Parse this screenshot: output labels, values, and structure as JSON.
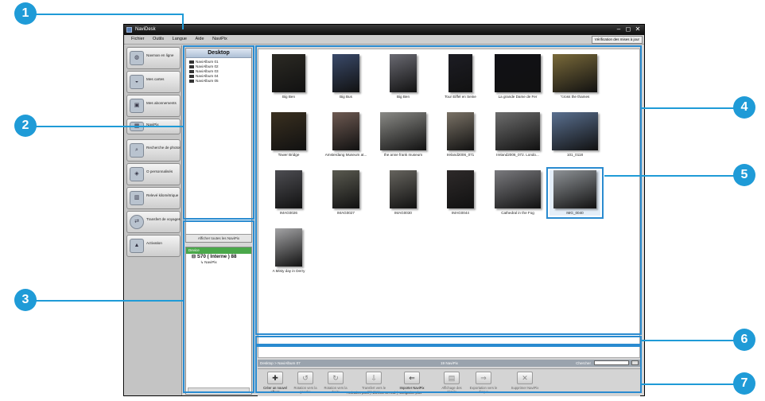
{
  "window": {
    "title": "NaviDesk",
    "minimize": "–",
    "maximize": "◻",
    "close": "✕"
  },
  "menu": {
    "items": [
      "Fichier",
      "Outils",
      "Langue",
      "Aide",
      "NaviPix"
    ],
    "update_button": "Vérification des mises à jour"
  },
  "sidebar": {
    "items": [
      {
        "label": "Navman en ligne",
        "icon": "globe-icon"
      },
      {
        "label": "Mes cartes",
        "icon": "map-icon"
      },
      {
        "label": "Mes abonnements",
        "icon": "subscription-icon"
      },
      {
        "label": "NaviPix",
        "icon": "photo-icon"
      },
      {
        "label": "Recherche de photos",
        "icon": "photo-search-icon"
      },
      {
        "label": "O personnalisés",
        "icon": "custom-poi-icon"
      },
      {
        "label": "Relevé kilométrique",
        "icon": "odometer-icon"
      },
      {
        "label": "Transfert de voyages",
        "icon": "transfer-icon"
      },
      {
        "label": "Activation",
        "icon": "lock-icon"
      }
    ]
  },
  "albums": {
    "header": "Desktop",
    "items": [
      "NaviAlbum 01",
      "NaviAlbum 02",
      "NaviAlbum 03",
      "NaviAlbum 04",
      "NaviAlbum 05"
    ],
    "show_all": "Afficher toutes les NaviPix"
  },
  "device_tree": {
    "header": "Device",
    "device": "S70 ( Interne ) 88",
    "child": "NaviPix"
  },
  "photos": [
    {
      "caption": "Big Ben",
      "color": "#2c2a24"
    },
    {
      "caption": "Big Bus",
      "color": "#3a4a6a"
    },
    {
      "caption": "Big Ben",
      "color": "#6a6a72"
    },
    {
      "caption": "Tour Eiffel en Seine",
      "color": "#1d1d24"
    },
    {
      "caption": "La grande Dame de Fer",
      "color": "#111116"
    },
    {
      "caption": "\"cross the thames",
      "color": "#7a6a3a"
    },
    {
      "caption": "Tower Bridge",
      "color": "#3a3020"
    },
    {
      "caption": "Amsterdang Museum at...",
      "color": "#6e5a52"
    },
    {
      "caption": "the anne frank museum",
      "color": "#8a8a86"
    },
    {
      "caption": "Ireland2006_071",
      "color": "#7a7266"
    },
    {
      "caption": "Ireland2006_072. Londo...",
      "color": "#6d6d6d"
    },
    {
      "caption": "101_0118",
      "color": "#5a7090"
    },
    {
      "caption": "IMAG0026",
      "color": "#4d4d52"
    },
    {
      "caption": "IMAG0027",
      "color": "#5a5a50"
    },
    {
      "caption": "IMAG0030",
      "color": "#66645e"
    },
    {
      "caption": "IMAG0044",
      "color": "#2e2a2a"
    },
    {
      "caption": "Cathedral in the Fog",
      "color": "#7a7a7e"
    },
    {
      "caption": "IMG_0040",
      "color": "#8e9296"
    },
    {
      "caption": "A Misty day in Derry",
      "color": "#a3a3a5"
    }
  ],
  "status": {
    "path": "Desktop > NaviAlbum 07",
    "count": "19 NaviPix",
    "search_label": "Chercher"
  },
  "toolbar": [
    {
      "label": "Créer un nouvel album",
      "icon": "new-album-icon",
      "glyph": "✚"
    },
    {
      "label": "Rotation vers la gauche",
      "icon": "rotate-left-icon",
      "glyph": "↺"
    },
    {
      "label": "Rotation vers la droite",
      "icon": "rotate-right-icon",
      "glyph": "↻"
    },
    {
      "label": "Transfert vers le Navman",
      "icon": "transfer-device-icon",
      "glyph": "⇩"
    },
    {
      "label": "Importer NaviPix",
      "icon": "import-icon",
      "glyph": "⇐"
    },
    {
      "label": "Affichage des détails",
      "icon": "details-icon",
      "glyph": "▤"
    },
    {
      "label": "Exportation vers le disque",
      "icon": "export-icon",
      "glyph": "⇒"
    },
    {
      "label": "Supprimer NaviPix",
      "icon": "delete-icon",
      "glyph": "✕"
    }
  ],
  "footer": "Activation pass | Navman UK Ltd. | Navigation plus",
  "callouts": [
    "1",
    "2",
    "3",
    "4",
    "5",
    "6",
    "7"
  ],
  "accent_color": "#1f9bd7"
}
